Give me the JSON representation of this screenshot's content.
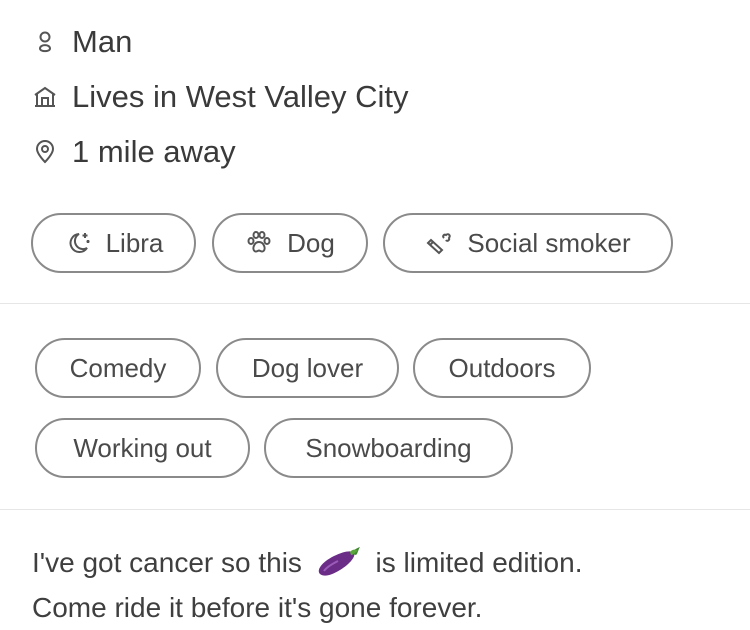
{
  "profile": {
    "gender": "Man",
    "lives_in": "Lives in West Valley City",
    "distance": "1 mile away"
  },
  "basics_chips": [
    {
      "label": "Libra",
      "icon": "zodiac-moon-icon"
    },
    {
      "label": "Dog",
      "icon": "paw-icon"
    },
    {
      "label": "Social smoker",
      "icon": "cigarette-icon"
    }
  ],
  "interest_chips": [
    {
      "label": "Comedy"
    },
    {
      "label": "Dog lover"
    },
    {
      "label": "Outdoors"
    },
    {
      "label": "Working out"
    },
    {
      "label": "Snowboarding"
    }
  ],
  "bio": {
    "part1": "I've got cancer so this",
    "emoji": "eggplant-emoji",
    "part2": "is limited edition.",
    "line2": "Come ride it before it's gone forever."
  },
  "colors": {
    "text": "#3a3a3a",
    "chip_border": "#8a8a8a",
    "divider": "#e6e6e6",
    "eggplant": "#6a2c86"
  }
}
